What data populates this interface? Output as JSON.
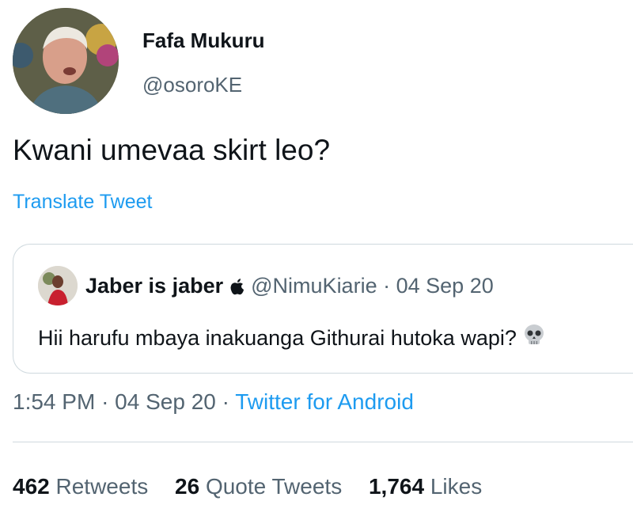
{
  "tweet": {
    "author_name": "Fafa Mukuru",
    "author_handle": "@osoroKE",
    "text": "Kwani umevaa skirt leo?",
    "translate_label": "Translate Tweet",
    "time": "1:54 PM",
    "separator": "·",
    "date": "04 Sep 20",
    "source": "Twitter for Android"
  },
  "quoted_tweet": {
    "author_name": "Jaber is jaber",
    "author_handle": "@NimuKiarie",
    "separator": "·",
    "date": "04 Sep 20",
    "text": "Hii harufu mbaya inakuanga Githurai hutoka wapi?",
    "name_icon": "apple-icon",
    "text_icon": "skull-emoji"
  },
  "stats": {
    "retweets_count": "462",
    "retweets_label": "Retweets",
    "quotes_count": "26",
    "quotes_label": "Quote Tweets",
    "likes_count": "1,764",
    "likes_label": "Likes"
  },
  "colors": {
    "link": "#1d9bf0",
    "secondary_text": "#536471",
    "border": "#cfd9de"
  }
}
